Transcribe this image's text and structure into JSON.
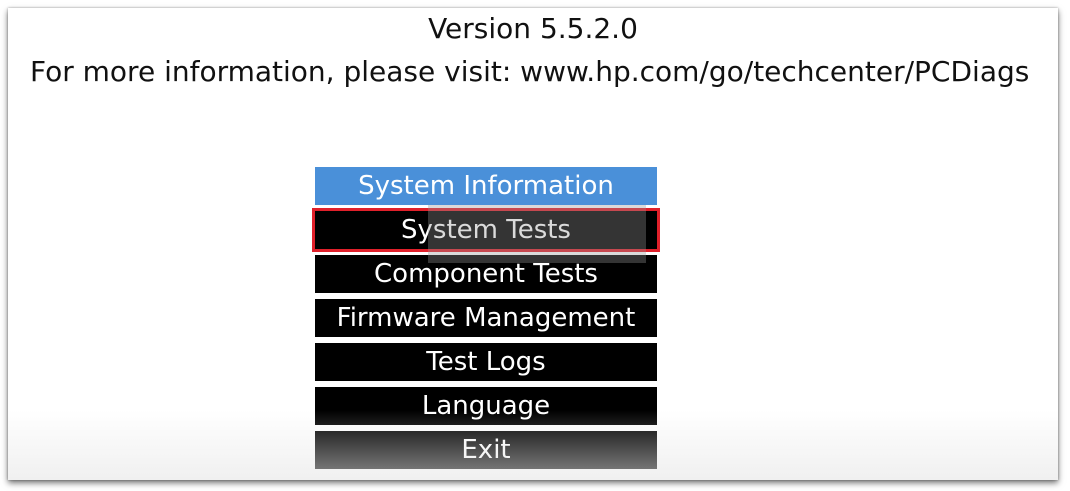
{
  "header": {
    "version": "Version 5.5.2.0",
    "info": "For more information, please visit: www.hp.com/go/techcenter/PCDiags"
  },
  "menu": {
    "items": [
      {
        "label": "System Information",
        "state": "selected"
      },
      {
        "label": "System Tests",
        "state": "highlighted"
      },
      {
        "label": "Component Tests",
        "state": "normal"
      },
      {
        "label": "Firmware Management",
        "state": "normal"
      },
      {
        "label": "Test Logs",
        "state": "normal"
      },
      {
        "label": "Language",
        "state": "normal"
      },
      {
        "label": "Exit",
        "state": "normal"
      }
    ]
  },
  "colors": {
    "selected_bg": "#4a90d9",
    "item_bg": "#000000",
    "highlight_border": "#e0202a",
    "text_light": "#ffffff",
    "text_dark": "#111111"
  }
}
